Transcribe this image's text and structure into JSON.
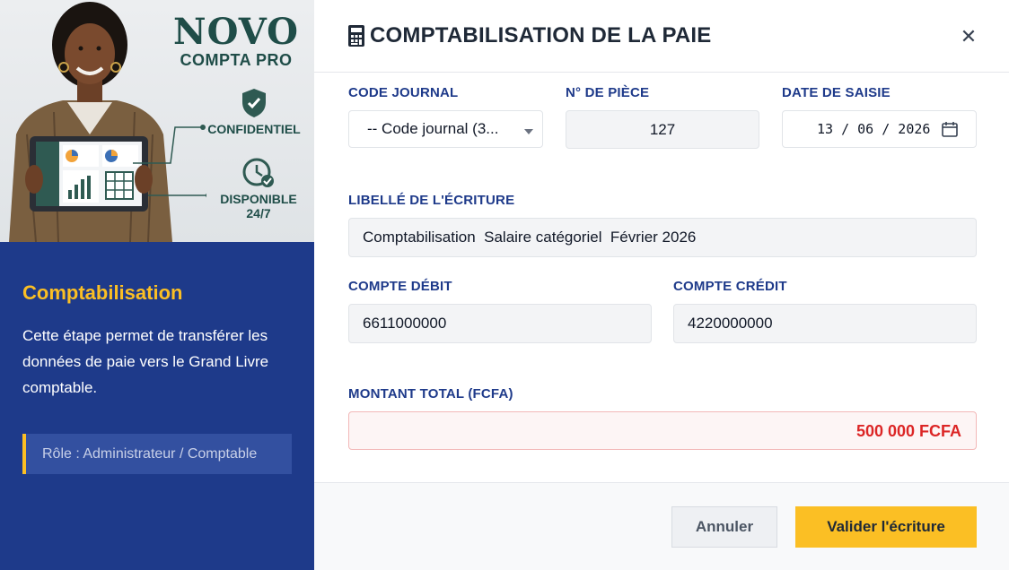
{
  "brand": {
    "name": "NOVO",
    "sub": "COMPTA PRO"
  },
  "features": [
    {
      "label": "CONFIDENTIEL"
    },
    {
      "line1": "DISPONIBLE",
      "line2": "24/7"
    }
  ],
  "sidebar": {
    "title": "Comptabilisation",
    "description": "Cette étape permet de transférer les données de paie vers le Grand Livre comptable.",
    "role": "Rôle : Administrateur / Comptable"
  },
  "modal": {
    "title": "COMPTABILISATION DE LA PAIE",
    "close_icon": "close-icon"
  },
  "form": {
    "code_journal": {
      "label": "CODE JOURNAL",
      "value": "-- Code journal (3..."
    },
    "piece": {
      "label": "N° DE PIÈCE",
      "value": "127"
    },
    "date": {
      "label": "DATE DE SAISIE",
      "value": "13 / 06 / 2026"
    },
    "libelle": {
      "label": "LIBELLÉ DE L'ÉCRITURE",
      "value": "Comptabilisation  Salaire catégoriel  Février 2026"
    },
    "compte_debit": {
      "label": "COMPTE DÉBIT",
      "value": "6611000000"
    },
    "compte_credit": {
      "label": "COMPTE CRÉDIT",
      "value": "4220000000"
    },
    "montant": {
      "label": "MONTANT TOTAL (FCFA)",
      "value": "500 000 FCFA"
    }
  },
  "actions": {
    "cancel": "Annuler",
    "submit": "Valider l'écriture"
  },
  "colors": {
    "sidebar_bg": "#1e3a8a",
    "accent": "#fbbf24",
    "amount": "#dc2626"
  }
}
